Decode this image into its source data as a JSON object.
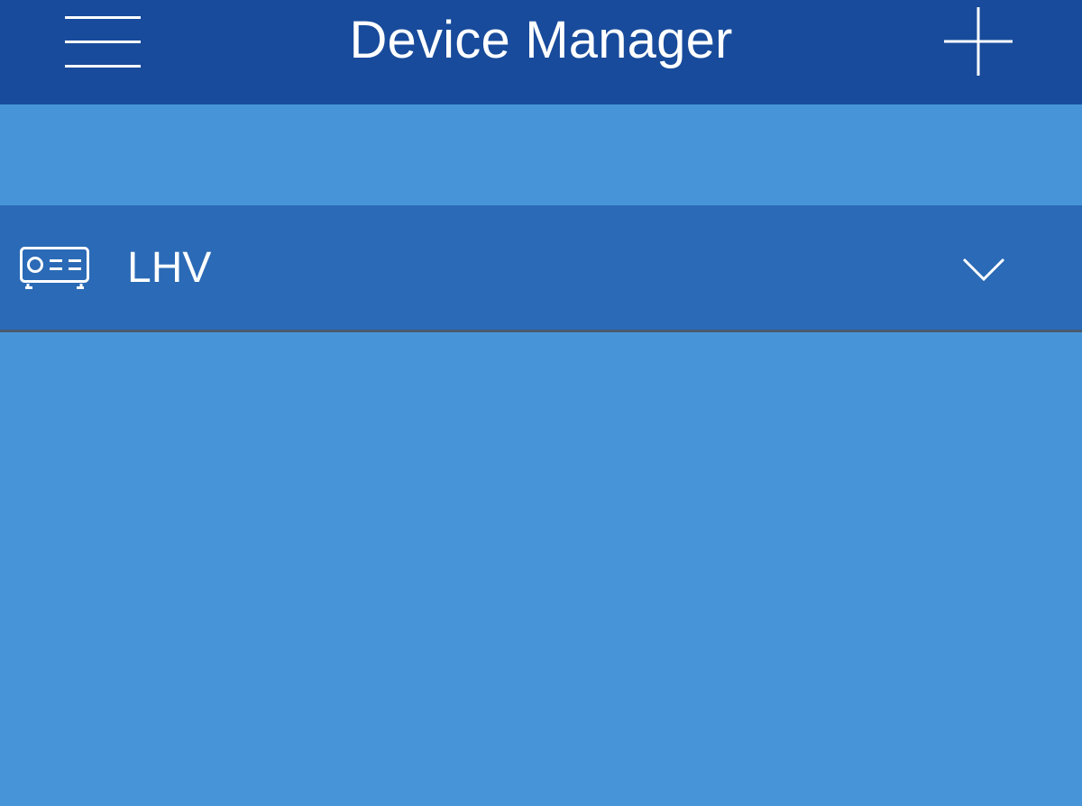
{
  "navbar": {
    "title": "Device Manager",
    "menu_icon": "hamburger-menu-icon",
    "add_icon": "plus-icon"
  },
  "devices": [
    {
      "name": "LHV",
      "icon": "projector-device-icon",
      "expand_icon": "chevron-down-icon"
    }
  ],
  "colors": {
    "navbar_bg": "#184b9b",
    "page_bg": "#4795d8",
    "row_bg": "#2b6ab6",
    "divider": "#4a5a6e",
    "text": "#ffffff"
  }
}
